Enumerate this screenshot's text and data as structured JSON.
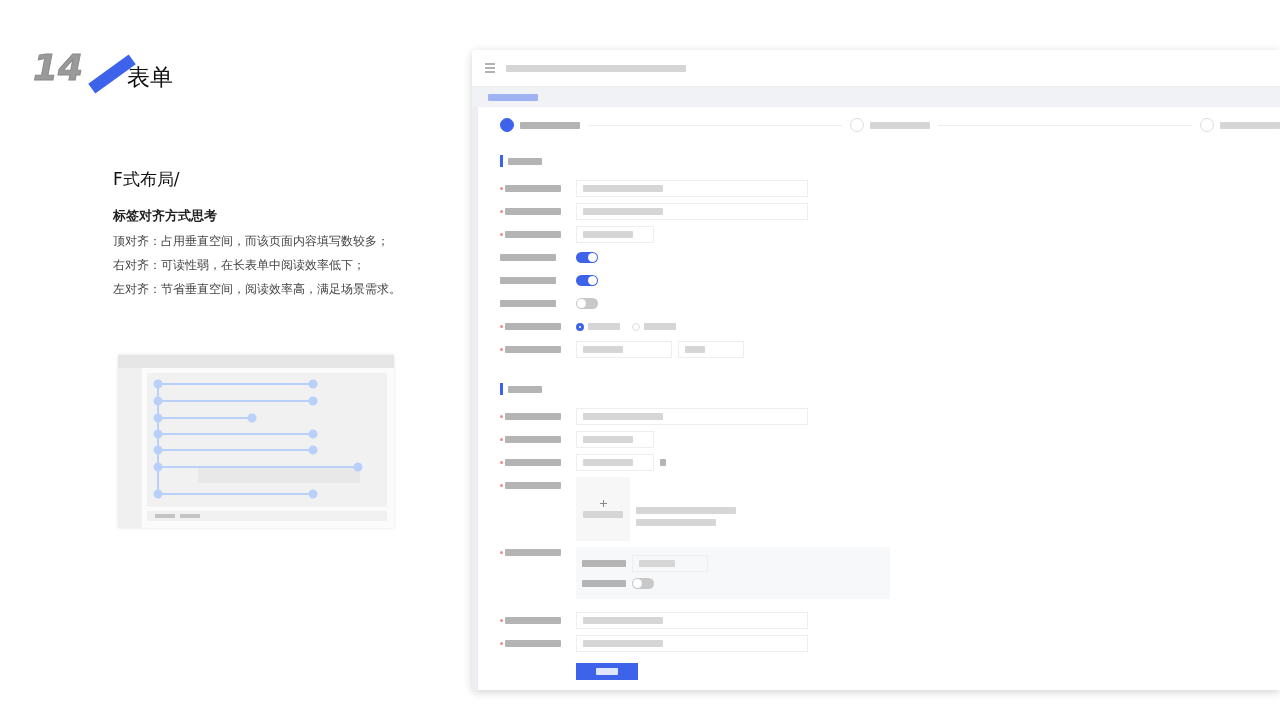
{
  "heading": {
    "number": "14",
    "title": "表单"
  },
  "subtitle": "F式布局/",
  "topic": "标签对齐方式思考",
  "points": [
    "顶对齐：占用垂直空间，而该页面内容填写数较多；",
    "右对齐：可读性弱，在长表单中阅读效率低下；",
    "左对齐：节省垂直空间，阅读效率高，满足场景需求。"
  ],
  "form": {
    "steps": [
      {
        "selected": true
      },
      {
        "selected": false
      },
      {
        "selected": false
      }
    ],
    "sections": [
      {
        "rows": [
          {
            "kind": "long-input",
            "required": true
          },
          {
            "kind": "long-input",
            "required": true
          },
          {
            "kind": "short-input",
            "required": true
          },
          {
            "kind": "switch",
            "required": false,
            "on": true
          },
          {
            "kind": "switch",
            "required": false,
            "on": true
          },
          {
            "kind": "switch",
            "required": false,
            "on": false
          },
          {
            "kind": "radio",
            "required": true,
            "options": [
              {
                "selected": true
              },
              {
                "selected": false
              }
            ]
          },
          {
            "kind": "date",
            "required": true
          }
        ]
      },
      {
        "rows": [
          {
            "kind": "long-input",
            "required": true
          },
          {
            "kind": "short-input",
            "required": true
          },
          {
            "kind": "suffix-input",
            "required": true
          },
          {
            "kind": "upload",
            "required": true
          },
          {
            "kind": "group",
            "required": true,
            "on": false
          },
          {
            "kind": "select",
            "required": true
          },
          {
            "kind": "long-input",
            "required": true
          }
        ]
      }
    ]
  }
}
